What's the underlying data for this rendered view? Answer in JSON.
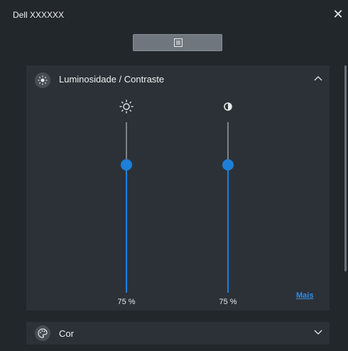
{
  "window": {
    "title": "Dell XXXXXX",
    "close_icon": "close-icon"
  },
  "toolbar": {
    "view_toggle_icon": "list-view-icon"
  },
  "brightness_contrast": {
    "title": "Luminosidade / Contraste",
    "expanded": true,
    "brightness": {
      "icon": "sun-icon",
      "value_percent": 75,
      "label": "75 %"
    },
    "contrast": {
      "icon": "contrast-icon",
      "value_percent": 75,
      "label": "75 %"
    },
    "more_link": "Mais"
  },
  "color": {
    "title": "Cor",
    "expanded": false
  },
  "colors": {
    "accent": "#1e7fd8",
    "background": "#22272c",
    "panel": "#2c3137"
  }
}
